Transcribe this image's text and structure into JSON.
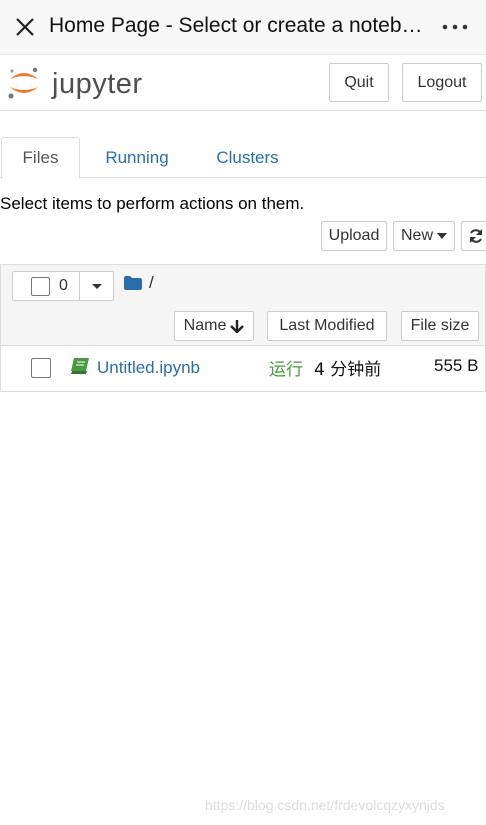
{
  "appbar": {
    "title": "Home Page - Select or create a notebo...",
    "close_icon": "close-icon",
    "more_icon": "more-vertical-icon"
  },
  "header": {
    "logo_text": "jupyter",
    "quit_label": "Quit",
    "logout_label": "Logout"
  },
  "tabs": [
    {
      "label": "Files",
      "active": true
    },
    {
      "label": "Running",
      "active": false
    },
    {
      "label": "Clusters",
      "active": false
    }
  ],
  "toolbar": {
    "info_text": "Select items to perform actions on them.",
    "upload_label": "Upload",
    "new_label": "New",
    "refresh_icon": "refresh-icon"
  },
  "list": {
    "selected_count": "0",
    "path": "/",
    "columns": {
      "name": "Name",
      "last_modified": "Last Modified",
      "file_size": "File size"
    },
    "items": [
      {
        "name": "Untitled.ipynb",
        "status": "运行",
        "modified": "4 分钟前",
        "size": "555 B"
      }
    ]
  },
  "watermark": "https://blog.csdn.net/frdevolcqzyxynjds",
  "colors": {
    "link": "#2a6dad",
    "running": "#4a9a42",
    "jupyter_orange": "#f37726"
  }
}
